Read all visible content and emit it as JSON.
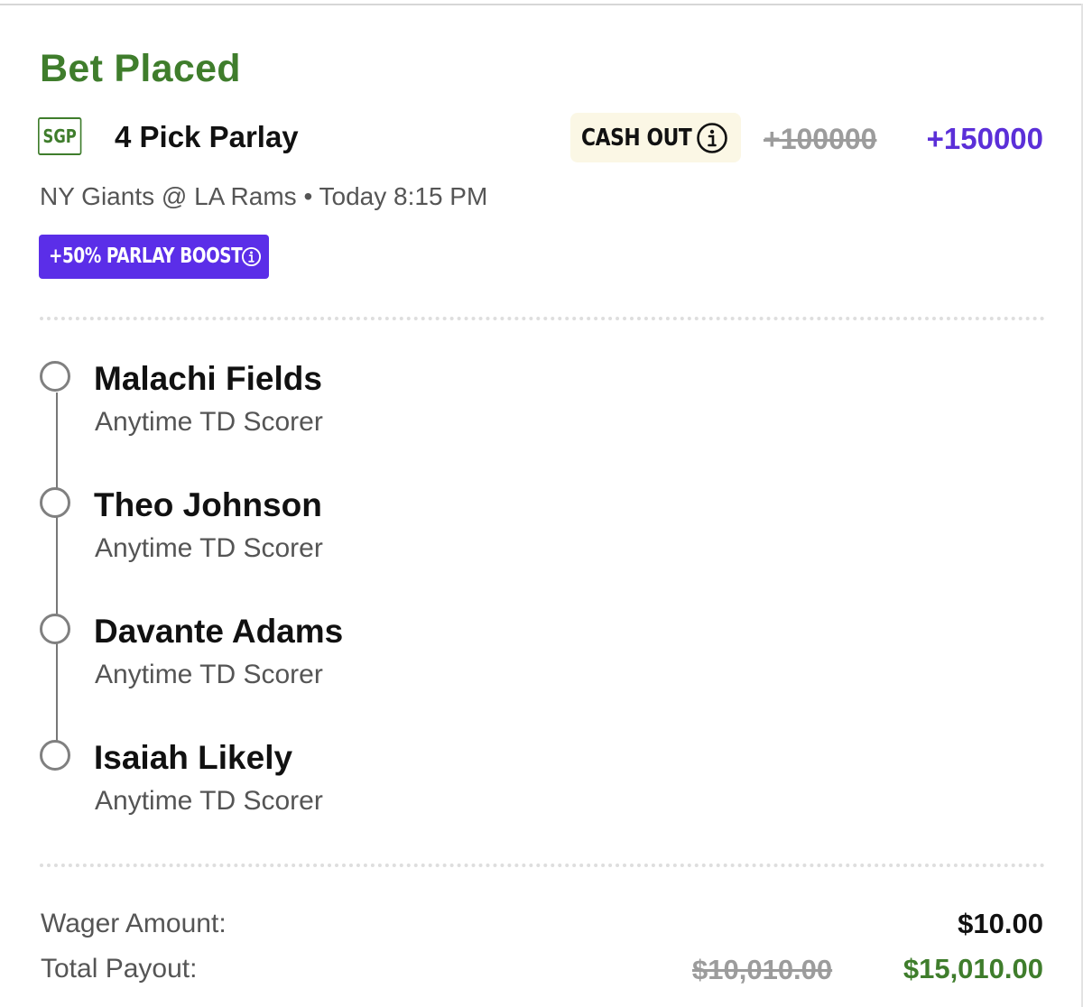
{
  "bet": {
    "status_title": "Bet Placed",
    "badge": "SGP",
    "name": "4 Pick Parlay",
    "cash_out_label": "CASH OUT",
    "odds_original": "+100000",
    "odds_boosted": "+150000",
    "matchup": "NY Giants @ LA Rams • Today 8:15 PM",
    "boost_label": "+50% PARLAY BOOST"
  },
  "legs": [
    {
      "player": "Malachi Fields",
      "market": "Anytime TD Scorer"
    },
    {
      "player": "Theo Johnson",
      "market": "Anytime TD Scorer"
    },
    {
      "player": "Davante Adams",
      "market": "Anytime TD Scorer"
    },
    {
      "player": "Isaiah Likely",
      "market": "Anytime TD Scorer"
    }
  ],
  "summary": {
    "wager_label": "Wager Amount:",
    "wager_value": "$10.00",
    "payout_label": "Total Payout:",
    "payout_original": "$10,010.00",
    "payout_boosted": "$15,010.00"
  },
  "colors": {
    "success_green": "#3f7d2c",
    "boost_purple": "#5b2ee8",
    "odds_purple": "#5b2fd8",
    "cashout_bg": "#fbf7e5",
    "muted_text": "#555555",
    "strike_text": "#9c9c9c"
  },
  "icons": {
    "cash_out_info": "info-circle-icon",
    "boost_info": "info-circle-icon",
    "leg_status": "open-circle-icon"
  }
}
